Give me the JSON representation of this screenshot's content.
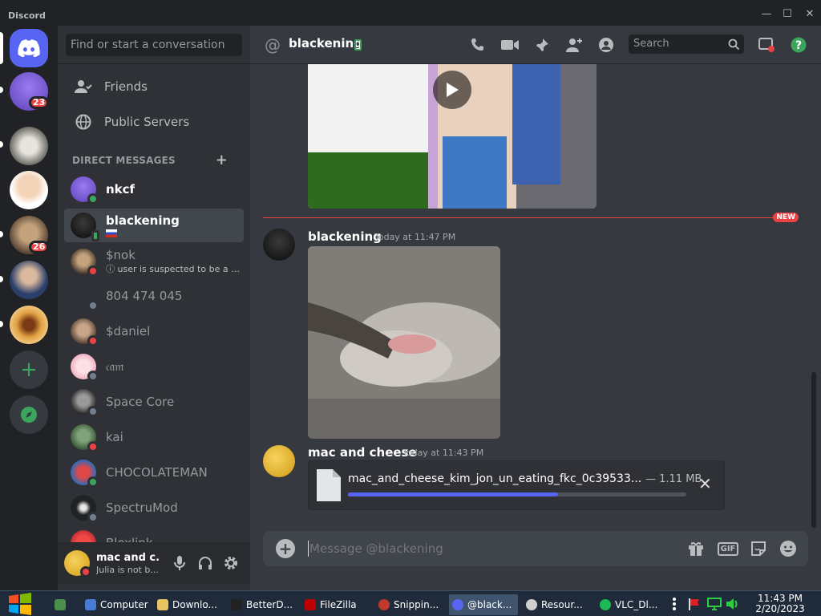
{
  "window": {
    "brand": "Discord",
    "controls": [
      "—",
      "☐",
      "✕"
    ]
  },
  "servers": [
    {
      "name": "server-1",
      "badge": "23"
    },
    {
      "name": "server-2",
      "badge": ""
    },
    {
      "name": "server-3",
      "badge": ""
    },
    {
      "name": "server-4",
      "badge": "26"
    },
    {
      "name": "server-5",
      "badge": ""
    },
    {
      "name": "server-6",
      "badge": ""
    }
  ],
  "sidebar": {
    "search_placeholder": "Find or start a conversation",
    "nav": [
      {
        "label": "Friends"
      },
      {
        "label": "Public Servers"
      }
    ],
    "dm_header": "DIRECT MESSAGES",
    "dm_add": "+",
    "dms": [
      {
        "name": "nkcf",
        "status": "online",
        "sub": ""
      },
      {
        "name": "blackening",
        "status": "mobile",
        "sub": ""
      },
      {
        "name": "$nok",
        "status": "dnd",
        "sub": "ⓘ user is suspected to be a p..."
      },
      {
        "name": "804 474 045",
        "status": "offline",
        "sub": ""
      },
      {
        "name": "$daniel",
        "status": "dnd",
        "sub": ""
      },
      {
        "name": "𝔠𝔞𝔪",
        "status": "offline",
        "sub": ""
      },
      {
        "name": "Space Core",
        "status": "offline",
        "sub": ""
      },
      {
        "name": "kai",
        "status": "dnd",
        "sub": ""
      },
      {
        "name": "CHOCOLATEMAN",
        "status": "online",
        "sub": ""
      },
      {
        "name": "SpectruMod",
        "status": "offline",
        "sub": ""
      },
      {
        "name": "Bloxlink",
        "status": "dnd",
        "sub": ""
      }
    ]
  },
  "user": {
    "name": "mac and c...",
    "status": "Julia is not b..."
  },
  "header": {
    "channel": "blackening",
    "search_placeholder": "Search"
  },
  "messages": {
    "new_tag": "NEW",
    "items": [
      {
        "author": "blackening",
        "time": "Today at 11:47 PM"
      },
      {
        "author": "mac and cheese",
        "time": "Today at 11:43 PM"
      }
    ],
    "upload": {
      "filename": "mac_and_cheese_kim_jon_un_eating_fkc_0c39533...",
      "size": "— 1.11 MB",
      "progress": 0.62
    }
  },
  "composer": {
    "placeholder": "Message @blackening"
  },
  "taskbar": {
    "items": [
      "Computer",
      "Downlo...",
      "BetterD...",
      "FileZilla",
      "Snippin...",
      "@black...",
      "Resour...",
      "VLC_Dl..."
    ],
    "time": "11:43 PM",
    "date": "2/20/2023"
  }
}
